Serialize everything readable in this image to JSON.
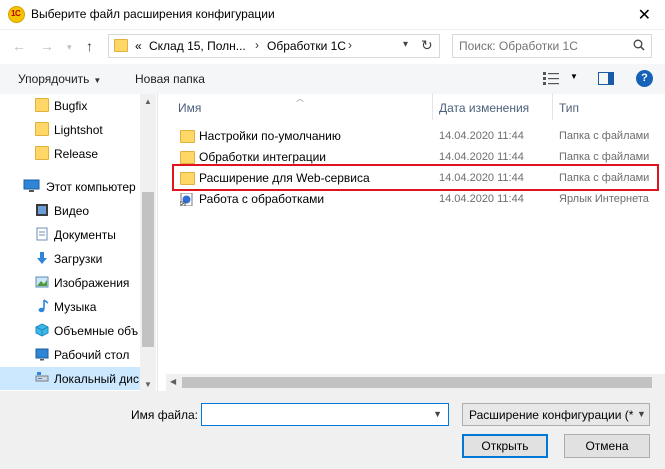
{
  "window": {
    "title": "Выберите файл расширения конфигурации",
    "app_icon_text": "1C"
  },
  "navigation": {
    "breadcrumb_overflow": "«",
    "breadcrumb": [
      "Склад 15, Полн...",
      "Обработки 1С"
    ],
    "search_placeholder": "Поиск: Обработки 1С"
  },
  "toolbar": {
    "organize_label": "Упорядочить",
    "new_folder_label": "Новая папка"
  },
  "sidebar": {
    "items": [
      {
        "label": "Bugfix",
        "icon": "folder-icon",
        "indent": 1
      },
      {
        "label": "Lightshot",
        "icon": "folder-icon",
        "indent": 1
      },
      {
        "label": "Release",
        "icon": "folder-icon",
        "indent": 1
      },
      {
        "label": "Этот компьютер",
        "icon": "computer-icon",
        "indent": 0
      },
      {
        "label": "Видео",
        "icon": "video-icon",
        "indent": 1
      },
      {
        "label": "Документы",
        "icon": "documents-icon",
        "indent": 1
      },
      {
        "label": "Загрузки",
        "icon": "downloads-icon",
        "indent": 1
      },
      {
        "label": "Изображения",
        "icon": "pictures-icon",
        "indent": 1
      },
      {
        "label": "Музыка",
        "icon": "music-icon",
        "indent": 1
      },
      {
        "label": "Объемные объ",
        "icon": "3d-objects-icon",
        "indent": 1
      },
      {
        "label": "Рабочий стол",
        "icon": "desktop-icon",
        "indent": 1
      },
      {
        "label": "Локальный дис",
        "icon": "local-disk-icon",
        "indent": 1,
        "selected": true
      }
    ]
  },
  "file_list": {
    "columns": [
      "Имя",
      "Дата изменения",
      "Тип"
    ],
    "rows": [
      {
        "name": "Настройки по-умолчанию",
        "date": "14.04.2020 11:44",
        "type": "Папка с файлами",
        "icon": "folder-icon"
      },
      {
        "name": "Обработки интеграции",
        "date": "14.04.2020 11:44",
        "type": "Папка с файлами",
        "icon": "folder-icon"
      },
      {
        "name": "Расширение для Web-сервиса",
        "date": "14.04.2020 11:44",
        "type": "Папка с файлами",
        "icon": "folder-icon",
        "highlighted": true
      },
      {
        "name": "Работа с обработками",
        "date": "14.04.2020 11:44",
        "type": "Ярлык Интернета",
        "icon": "internet-shortcut-icon"
      }
    ],
    "highlight_color": "#e0141e"
  },
  "footer": {
    "filename_label": "Имя файла:",
    "filename_value": "",
    "filter_value": "Расширение конфигурации (*",
    "open_label": "Открыть",
    "cancel_label": "Отмена"
  },
  "colors": {
    "accent": "#0078d7",
    "selection": "#cce8ff",
    "folder": "#ffd767"
  }
}
